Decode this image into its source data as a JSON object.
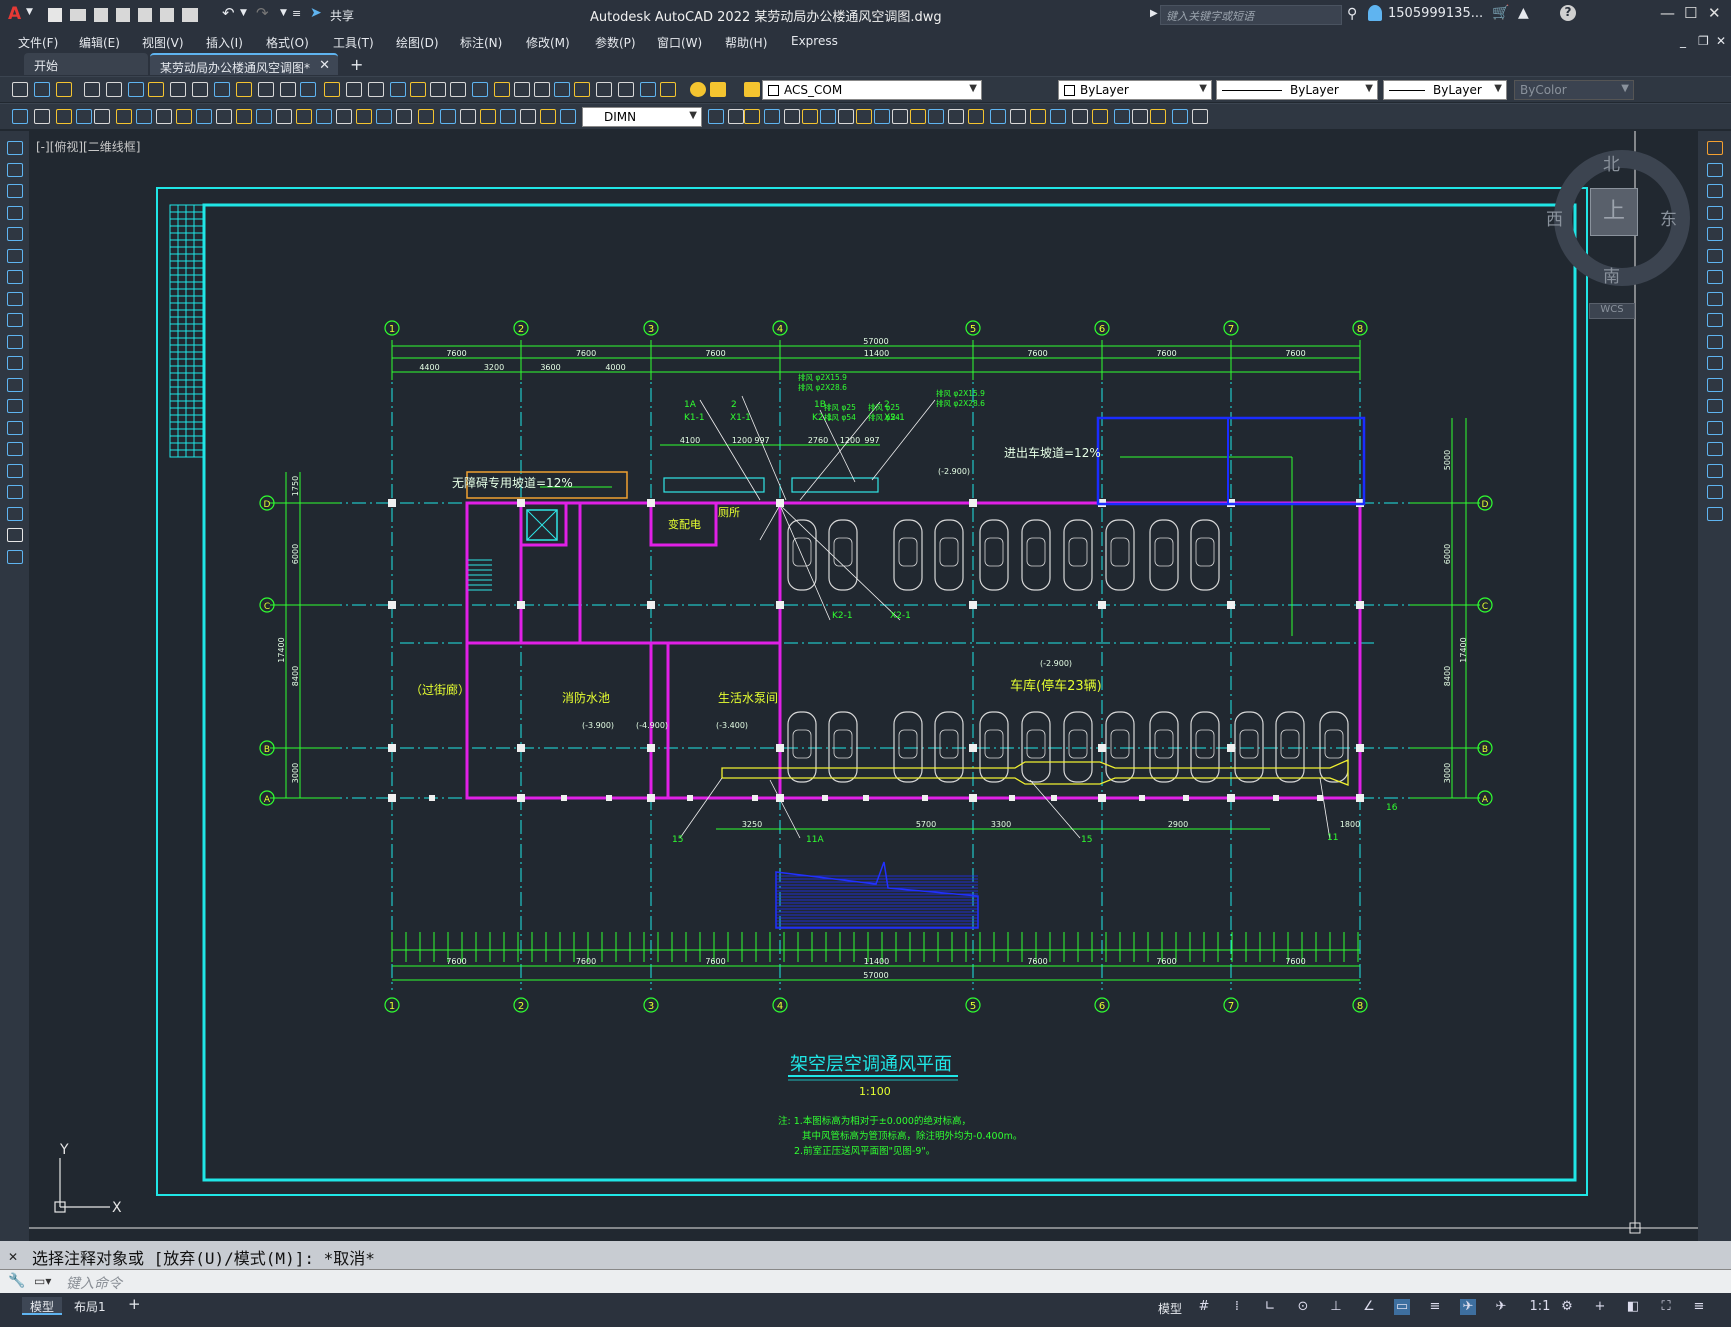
{
  "app": {
    "logo": "A",
    "title": "Autodesk AutoCAD 2022    某劳动局办公楼通风空调图.dwg",
    "share_label": "共享",
    "search_placeholder": "键入关键字或短语",
    "user": "1505999135..."
  },
  "menu": [
    "文件(F)",
    "编辑(E)",
    "视图(V)",
    "插入(I)",
    "格式(O)",
    "工具(T)",
    "绘图(D)",
    "标注(N)",
    "修改(M)",
    "参数(P)",
    "窗口(W)",
    "帮助(H)",
    "Express"
  ],
  "tabs": [
    {
      "label": "开始",
      "active": false
    },
    {
      "label": "某劳动局办公楼通风空调图*",
      "active": true
    }
  ],
  "toolbar": {
    "layer_name": "ACS_COM",
    "color": "ByLayer",
    "linetype": "ByLayer",
    "lineweight": "ByLayer",
    "plotstyle": "ByColor",
    "dimstyle": "DIMN"
  },
  "viewport_label": "[-][俯视][二维线框]",
  "viewcube": {
    "north": "北",
    "south": "南",
    "east": "东",
    "west": "西",
    "top": "上",
    "wcs": "WCS"
  },
  "drawing": {
    "title": "架空层空调通风平面",
    "scale": "1:100",
    "notes": [
      "注: 1.本图标高为相对于±0.000的绝对标高，",
      "其中风管标高为管顶标高，除注明外均为-0.400m。",
      "2.前室正压送风平面图\"见图-9\"。"
    ],
    "axis_numbers": [
      "1",
      "2",
      "3",
      "4",
      "5",
      "6",
      "7",
      "8"
    ],
    "axis_letters": [
      "D",
      "C",
      "B",
      "A"
    ],
    "top_dims_overall": "57000",
    "top_dims_spans": [
      "7600",
      "7600",
      "7600",
      "11400",
      "7600",
      "7600",
      "7600"
    ],
    "top_dims_sub": [
      "4400",
      "3200",
      "3600",
      "4000"
    ],
    "bottom_dims_spans": [
      "7600",
      "7600",
      "7600",
      "11400",
      "7600",
      "7600",
      "7600"
    ],
    "bottom_dims_overall": "57000",
    "left_dims": [
      "1750",
      "6000",
      "8400",
      "3000",
      "17400"
    ],
    "right_dims": [
      "5000",
      "6000",
      "8400",
      "3000",
      "17400"
    ],
    "labels": {
      "ramp_bike": "无障碍专用坡道=12%",
      "ramp_car": "进出车坡道=12%",
      "transformer": "变配电",
      "fire_pool": "消防水池",
      "pump": "生活水泵间",
      "corridor": "（过街廊）",
      "garage": "车库(停车23辆)",
      "toilet": "厕所",
      "lvl1": "(-3.900)",
      "lvl2": "(-4.900)",
      "lvl3": "(-3.400)",
      "lvl4": "(-2.900)",
      "lvl5": "(-2.900)"
    },
    "tags": [
      "1A",
      "2",
      "1B",
      "2",
      "K1-1",
      "X1-1",
      "K2-1",
      "X2-1",
      "K2-1",
      "X2-1",
      "15",
      "11A",
      "15",
      "11",
      "16"
    ],
    "duct_specs": [
      "排风 φ2X15.9",
      "排风 φ2X28.6",
      "排风 φ25",
      "排风 φ54",
      "排风 φ25",
      "排风 φ54",
      "排风 φ2X15.9",
      "排风 φ2X28.6"
    ],
    "small_dims": [
      "4100",
      "1200",
      "997",
      "2760",
      "1200",
      "997",
      "3250",
      "5700",
      "3300",
      "2900",
      "1800"
    ]
  },
  "command": {
    "history": "选择注释对象或 [放弃(U)/模式(M)]: *取消*",
    "placeholder": "键入命令"
  },
  "status": {
    "tabs": [
      "模型",
      "布局1"
    ],
    "model_label": "模型",
    "scale": "1:1"
  }
}
